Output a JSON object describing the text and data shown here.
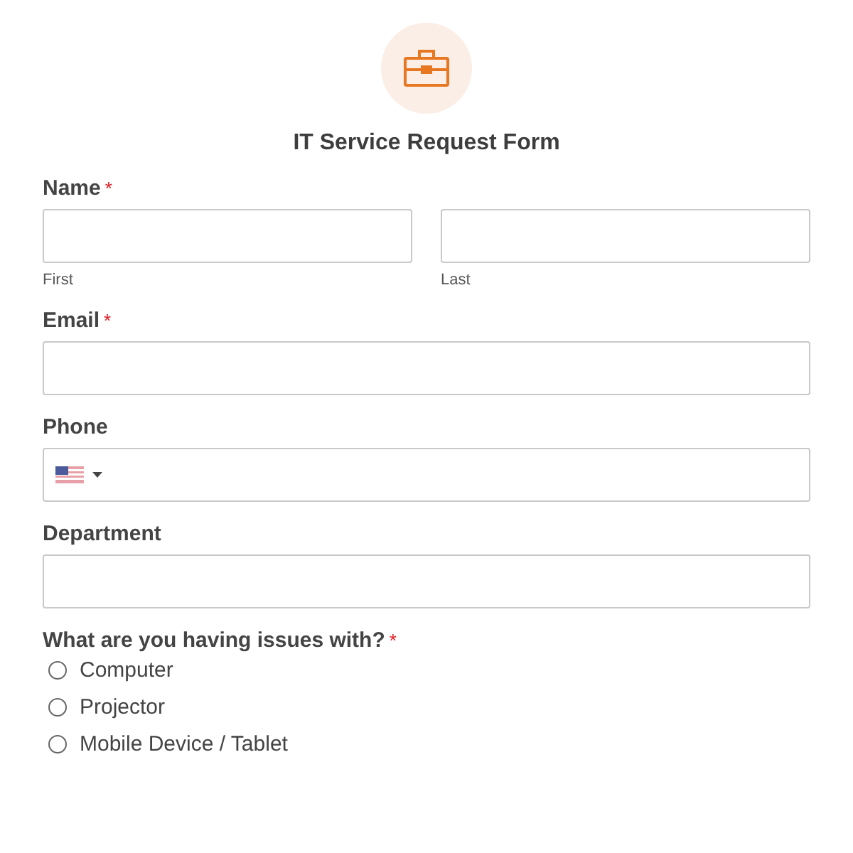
{
  "form": {
    "title": "IT Service Request Form"
  },
  "fields": [
    {
      "kind": "name",
      "label": "Name",
      "required_mark": "*",
      "parts": [
        {
          "sublabel": "First"
        },
        {
          "sublabel": "Last"
        }
      ]
    },
    {
      "kind": "text",
      "label": "Email",
      "required_mark": "*"
    },
    {
      "kind": "phone",
      "label": "Phone"
    },
    {
      "kind": "text",
      "label": "Department"
    },
    {
      "kind": "radio",
      "label": "What are you having issues with?",
      "required_mark": "*",
      "options": [
        {
          "label": "Computer",
          "selected": false
        },
        {
          "label": "Projector",
          "selected": false
        },
        {
          "label": "Mobile Device / Tablet",
          "selected": false
        }
      ]
    }
  ]
}
